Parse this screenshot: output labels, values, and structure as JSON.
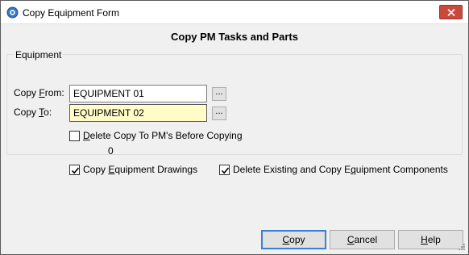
{
  "window": {
    "title": "Copy Equipment Form"
  },
  "form": {
    "heading": "Copy PM Tasks and Parts",
    "group_label": "Equipment",
    "copy_from": {
      "label_pre": "Copy ",
      "label_key": "F",
      "label_post": "rom:",
      "value": "EQUIPMENT 01",
      "browse_label": "..."
    },
    "copy_to": {
      "label_pre": "Copy ",
      "label_key": "T",
      "label_post": "o:",
      "value": "EQUIPMENT 02",
      "browse_label": "..."
    },
    "delete_pms": {
      "label_key": "D",
      "label_post": "elete Copy To PM's Before Copying",
      "checked": false
    },
    "counter": "0",
    "copy_drawings": {
      "label_pre": "Copy ",
      "label_key": "E",
      "label_post": "quipment Drawings",
      "checked": true
    },
    "copy_components": {
      "label_pre": "Delete Existing and Copy E",
      "label_key": "q",
      "label_post": "uipment Components",
      "checked": true
    }
  },
  "buttons": {
    "copy": {
      "key": "C",
      "rest": "opy"
    },
    "cancel": {
      "key": "C",
      "rest": "ancel"
    },
    "help": {
      "key": "H",
      "rest": "elp"
    }
  },
  "colors": {
    "close_button": "#c94a3d",
    "active_field": "#fffcc8",
    "default_button_border": "#3c7fd6"
  },
  "icons": {
    "app": "gear-icon",
    "close": "close-icon",
    "check": "checkmark-icon"
  }
}
